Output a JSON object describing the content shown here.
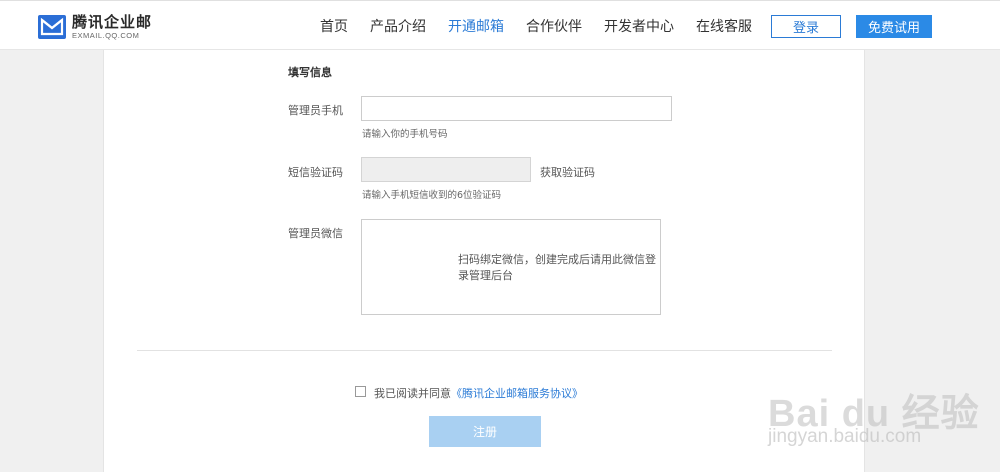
{
  "header": {
    "logo_cn": "腾讯企业邮",
    "logo_en": "EXMAIL.QQ.COM",
    "nav": [
      {
        "label": "首页"
      },
      {
        "label": "产品介绍"
      },
      {
        "label": "开通邮箱",
        "active": true
      },
      {
        "label": "合作伙伴"
      },
      {
        "label": "开发者中心"
      },
      {
        "label": "在线客服"
      }
    ],
    "login_label": "登录",
    "trial_label": "免费试用"
  },
  "form": {
    "section_title": "填写信息",
    "phone_label": "管理员手机",
    "phone_value": "",
    "phone_hint": "请输入你的手机号码",
    "sms_label": "短信验证码",
    "sms_value": "",
    "sms_link": "获取验证码",
    "sms_hint": "请输入手机短信收到的6位验证码",
    "wechat_label": "管理员微信",
    "wechat_qr_text": "扫码绑定微信，创建完成后请用此微信登录管理后台",
    "agree_text": "我已阅读并同意",
    "agree_link": "《腾讯企业邮箱服务协议》",
    "agree_checked": false,
    "register_label": "注册"
  },
  "watermark": {
    "top": "Bai du 经验",
    "bottom": "jingyan.baidu.com"
  },
  "colors": {
    "accent": "#2b7bd6",
    "register_button": "#a9d0f2"
  }
}
